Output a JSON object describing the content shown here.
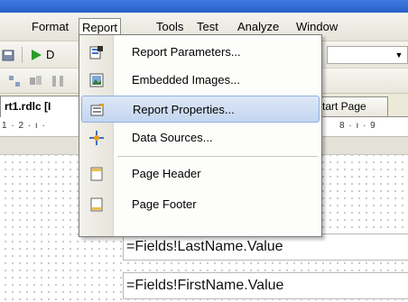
{
  "menubar": {
    "items": [
      {
        "label": "Format"
      },
      {
        "label": "Report"
      },
      {
        "label": "Tools"
      },
      {
        "label": "Test"
      },
      {
        "label": "Analyze"
      },
      {
        "label": "Window"
      }
    ]
  },
  "toolbar": {
    "combo_value": "",
    "play_label": "D"
  },
  "tabs": {
    "active": "rt1.rdlc [I",
    "start_page": "tart Page"
  },
  "ruler": {
    "left": "1 · 2 · ı ·",
    "right": "8 · ı · 9"
  },
  "report_menu": {
    "items": [
      {
        "label": "Report Parameters...",
        "icon": "report-parameters-icon"
      },
      {
        "label": "Embedded Images...",
        "icon": "embedded-images-icon"
      },
      {
        "label": "Report Properties...",
        "icon": "report-properties-icon",
        "highlighted": true
      },
      {
        "label": "Data Sources...",
        "icon": "data-sources-icon"
      },
      {
        "label": "Page Header",
        "icon": "page-header-icon"
      },
      {
        "label": "Page Footer",
        "icon": "page-footer-icon"
      }
    ]
  },
  "design": {
    "fields": [
      {
        "value": "=Fields!LastName.Value"
      },
      {
        "value": "=Fields!FirstName.Value"
      }
    ]
  },
  "colors": {
    "highlight": "#c3d5ef",
    "titlebar": "#2a5fc8"
  }
}
